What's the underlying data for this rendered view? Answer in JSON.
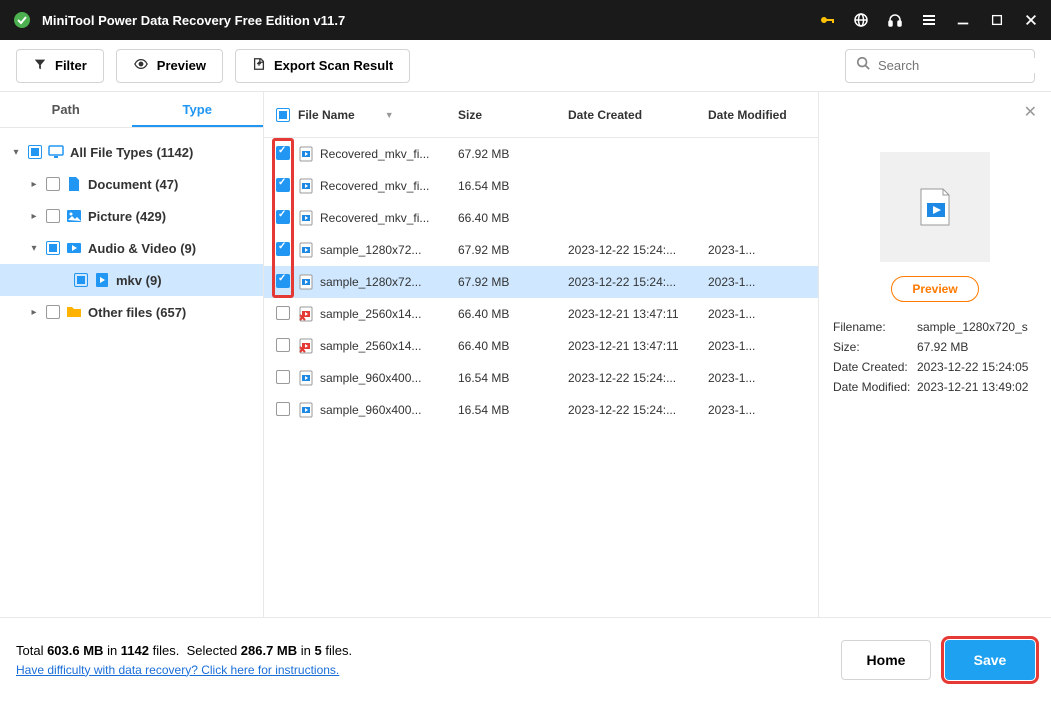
{
  "titlebar": {
    "title": "MiniTool Power Data Recovery Free Edition v11.7"
  },
  "toolbar": {
    "filter": "Filter",
    "preview": "Preview",
    "export": "Export Scan Result",
    "search_placeholder": "Search"
  },
  "tabs": {
    "path": "Path",
    "type": "Type"
  },
  "tree": {
    "root": "All File Types (1142)",
    "document": "Document (47)",
    "picture": "Picture (429)",
    "audiovideo": "Audio & Video (9)",
    "mkv": "mkv (9)",
    "other": "Other files (657)"
  },
  "columns": {
    "name": "File Name",
    "size": "Size",
    "date": "Date Created",
    "mod": "Date Modified"
  },
  "files": [
    {
      "checked": true,
      "name": "Recovered_mkv_fi...",
      "size": "67.92 MB",
      "date": "",
      "mod": "",
      "sel": false,
      "bad": false
    },
    {
      "checked": true,
      "name": "Recovered_mkv_fi...",
      "size": "16.54 MB",
      "date": "",
      "mod": "",
      "sel": false,
      "bad": false
    },
    {
      "checked": true,
      "name": "Recovered_mkv_fi...",
      "size": "66.40 MB",
      "date": "",
      "mod": "",
      "sel": false,
      "bad": false
    },
    {
      "checked": true,
      "name": "sample_1280x72...",
      "size": "67.92 MB",
      "date": "2023-12-22 15:24:...",
      "mod": "2023-1...",
      "sel": false,
      "bad": false
    },
    {
      "checked": true,
      "name": "sample_1280x72...",
      "size": "67.92 MB",
      "date": "2023-12-22 15:24:...",
      "mod": "2023-1...",
      "sel": true,
      "bad": false
    },
    {
      "checked": false,
      "name": "sample_2560x14...",
      "size": "66.40 MB",
      "date": "2023-12-21 13:47:11",
      "mod": "2023-1...",
      "sel": false,
      "bad": true
    },
    {
      "checked": false,
      "name": "sample_2560x14...",
      "size": "66.40 MB",
      "date": "2023-12-21 13:47:11",
      "mod": "2023-1...",
      "sel": false,
      "bad": true
    },
    {
      "checked": false,
      "name": "sample_960x400...",
      "size": "16.54 MB",
      "date": "2023-12-22 15:24:...",
      "mod": "2023-1...",
      "sel": false,
      "bad": false
    },
    {
      "checked": false,
      "name": "sample_960x400...",
      "size": "16.54 MB",
      "date": "2023-12-22 15:24:...",
      "mod": "2023-1...",
      "sel": false,
      "bad": false
    }
  ],
  "preview": {
    "button": "Preview",
    "filename_k": "Filename:",
    "filename_v": "sample_1280x720_s",
    "size_k": "Size:",
    "size_v": "67.92 MB",
    "created_k": "Date Created:",
    "created_v": "2023-12-22 15:24:05",
    "modified_k": "Date Modified:",
    "modified_v": "2023-12-21 13:49:02"
  },
  "footer": {
    "total_a": "Total ",
    "total_b": "603.6 MB",
    "total_c": " in ",
    "total_d": "1142",
    "total_e": " files.",
    "sel_a": "Selected ",
    "sel_b": "286.7 MB",
    "sel_c": " in ",
    "sel_d": "5",
    "sel_e": " files.",
    "help": "Have difficulty with data recovery? Click here for instructions.",
    "home": "Home",
    "save": "Save"
  }
}
